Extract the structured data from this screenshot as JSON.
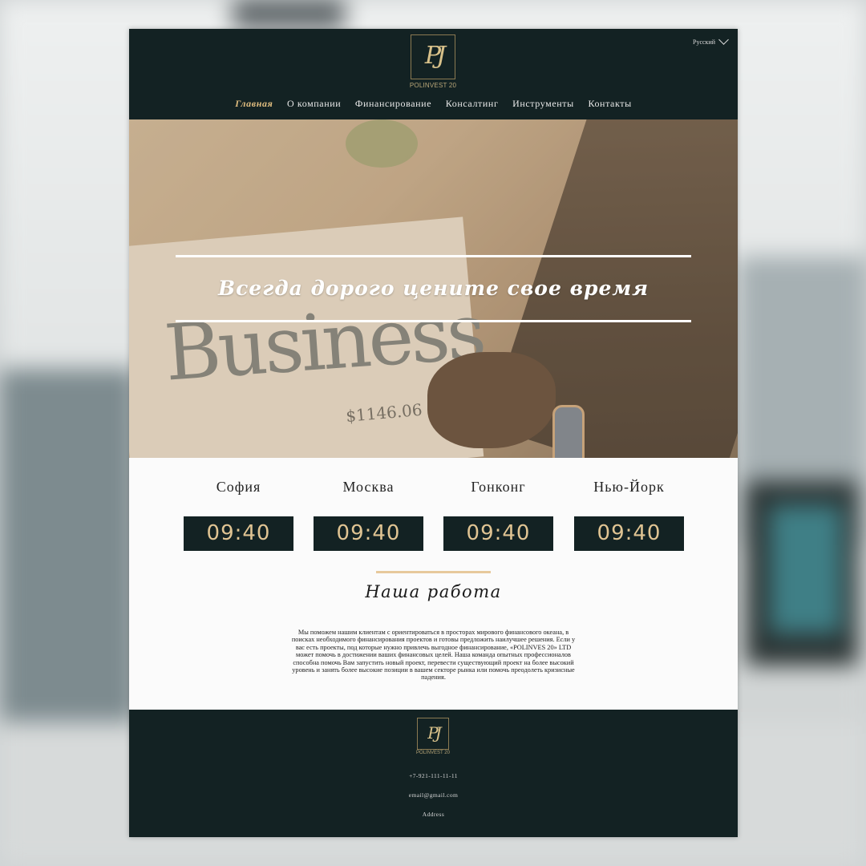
{
  "header": {
    "logo_monogram": "PJ",
    "logo_text": "POLINVEST 20",
    "language": "Русский",
    "nav": [
      {
        "label": "Главная",
        "active": true
      },
      {
        "label": "О компании",
        "active": false
      },
      {
        "label": "Финансирование",
        "active": false
      },
      {
        "label": "Консалтинг",
        "active": false
      },
      {
        "label": "Инструменты",
        "active": false
      },
      {
        "label": "Контакты",
        "active": false
      }
    ]
  },
  "hero": {
    "title": "Всегда дорого цените свое время"
  },
  "clocks": [
    {
      "city": "София",
      "time": "09:40"
    },
    {
      "city": "Москва",
      "time": "09:40"
    },
    {
      "city": "Гонконг",
      "time": "09:40"
    },
    {
      "city": "Нью-Йорк",
      "time": "09:40"
    }
  ],
  "work": {
    "title": "Наша работа",
    "text": "Мы поможем нашим клиентам с ориентироваться в просторах мирового финансового океана, в поисках необходимого финансирования проектов и готовы предложить наилучшее решения. Если у вас есть проекты, под которые нужно привлечь выгодное финансирование, «POLINVES 20» LTD может помочь в достижении ваших финансовых целей. Наша команда опытных профессионалов способна помочь Вам запустить новый проект, перевести существующий проект на более высокий уровень и занять более высокие позиции в вашем секторе рынка или помочь преодолеть кризисные падения."
  },
  "footer": {
    "logo_monogram": "PJ",
    "logo_text": "POLINVEST 20",
    "phone": "+7-921-111-11-11",
    "email": "email@gmail.com",
    "address": "Address"
  },
  "colors": {
    "dark": "#132223",
    "accent": "#e0bd7f"
  }
}
